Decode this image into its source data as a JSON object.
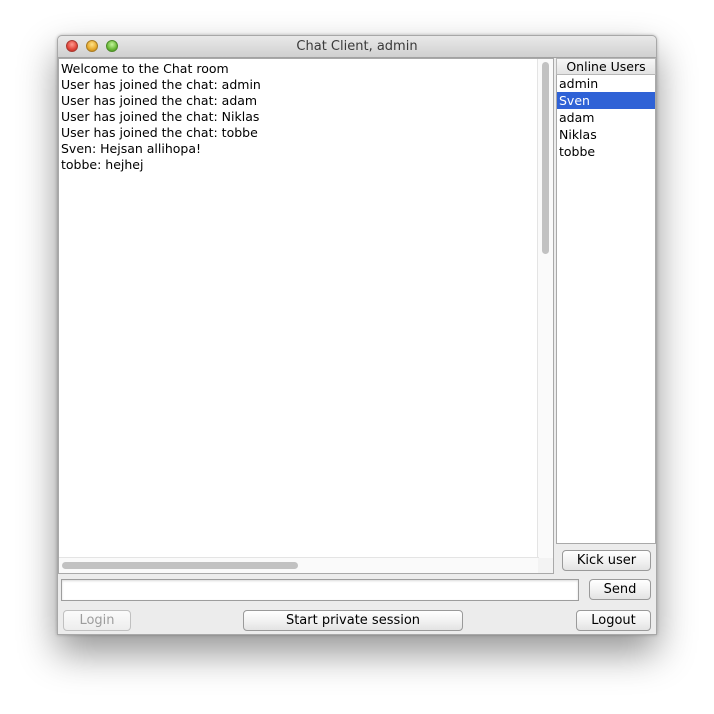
{
  "window": {
    "title": "Chat Client, admin"
  },
  "chat": {
    "lines": [
      "Welcome to the Chat room",
      "User has joined the chat: admin",
      "User has joined the chat: adam",
      "User has joined the chat: Niklas",
      "User has joined the chat: tobbe",
      "Sven: Hejsan allihopa!",
      "tobbe: hejhej"
    ]
  },
  "users": {
    "header": "Online Users",
    "items": [
      "admin",
      "Sven",
      "adam",
      "Niklas",
      "tobbe"
    ],
    "selected": "Sven"
  },
  "controls": {
    "kick_label": "Kick user",
    "send_label": "Send",
    "login_label": "Login",
    "private_label": "Start private session",
    "logout_label": "Logout",
    "message_value": ""
  },
  "colors": {
    "selection": "#2f62d6"
  }
}
